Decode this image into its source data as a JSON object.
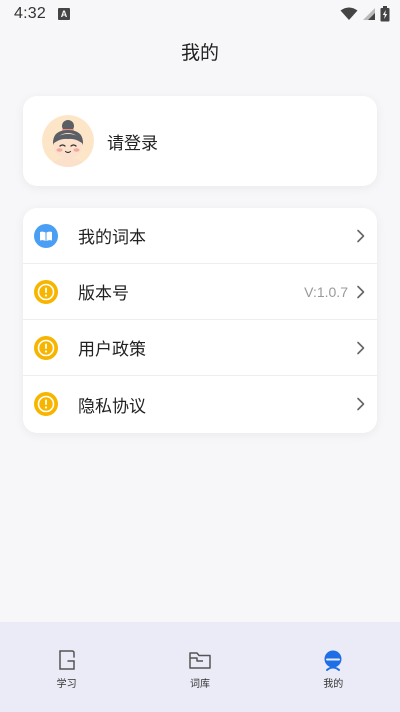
{
  "status_bar": {
    "time": "4:32",
    "notification_icon": "a-icon",
    "icons": [
      "wifi-icon",
      "signal-icon",
      "battery-charging-icon"
    ]
  },
  "header": {
    "title": "我的"
  },
  "profile": {
    "login_prompt": "请登录",
    "avatar_icon": "cartoon-avatar"
  },
  "menu": {
    "items": [
      {
        "label": "我的词本",
        "icon": "book-icon",
        "icon_color": "#4a9ff5",
        "value": ""
      },
      {
        "label": "版本号",
        "icon": "info-icon",
        "icon_color": "#f7b500",
        "value": "V:1.0.7"
      },
      {
        "label": "用户政策",
        "icon": "info-icon",
        "icon_color": "#f7b500",
        "value": ""
      },
      {
        "label": "隐私协议",
        "icon": "info-icon",
        "icon_color": "#f7b500",
        "value": ""
      }
    ]
  },
  "tab_bar": {
    "tabs": [
      {
        "label": "学习",
        "icon": "study-icon",
        "active": false
      },
      {
        "label": "词库",
        "icon": "folder-icon",
        "active": false
      },
      {
        "label": "我的",
        "icon": "profile-icon",
        "active": true
      }
    ],
    "active_color": "#1e6fe6",
    "inactive_color": "#555555"
  }
}
